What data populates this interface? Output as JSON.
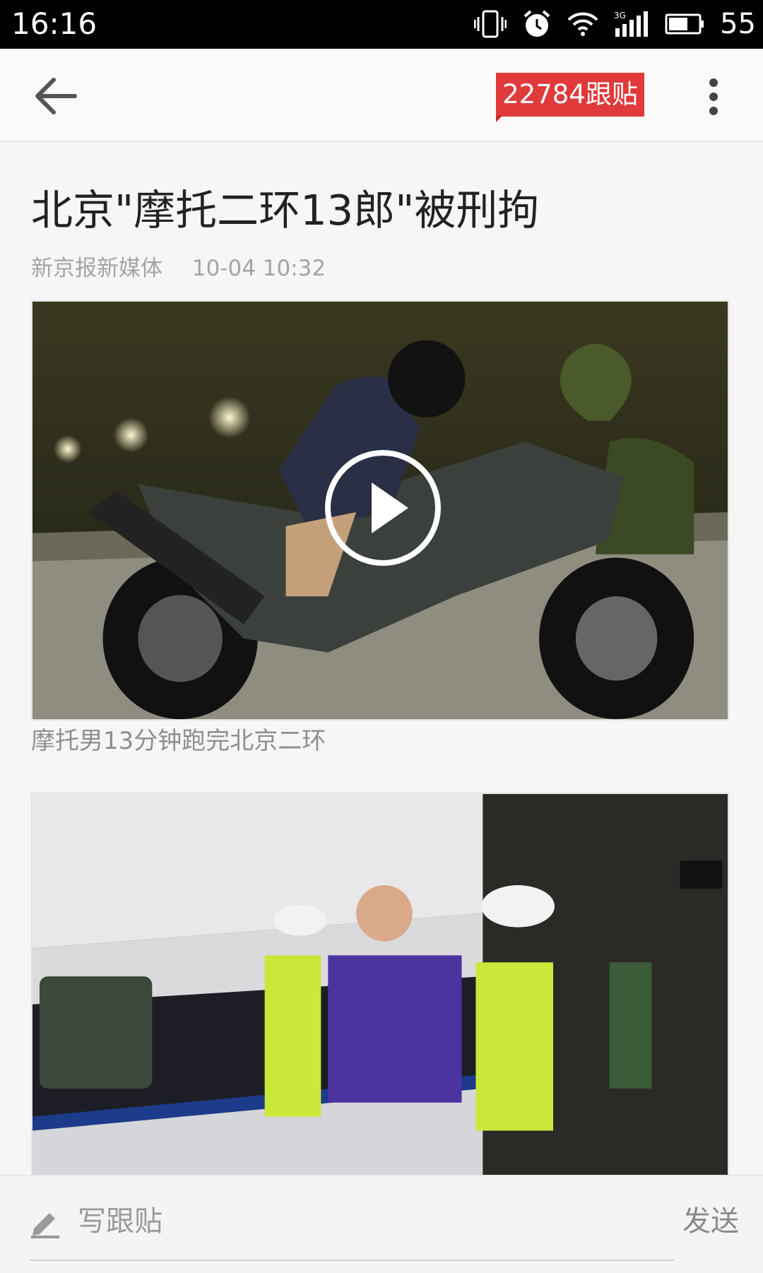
{
  "status_bar": {
    "time": "16:16",
    "network": "3G",
    "battery": "55"
  },
  "topbar": {
    "comment_count": "22784跟贴"
  },
  "article": {
    "title": "北京\"摩托二环13郎\"被刑拘",
    "source": "新京报新媒体",
    "datetime": "10-04 10:32",
    "video_caption": "摩托男13分钟跑完北京二环"
  },
  "composer": {
    "placeholder": "写跟贴",
    "send_label": "发送"
  },
  "colors": {
    "accent": "#e03a3a",
    "background": "#f6f6f6"
  }
}
